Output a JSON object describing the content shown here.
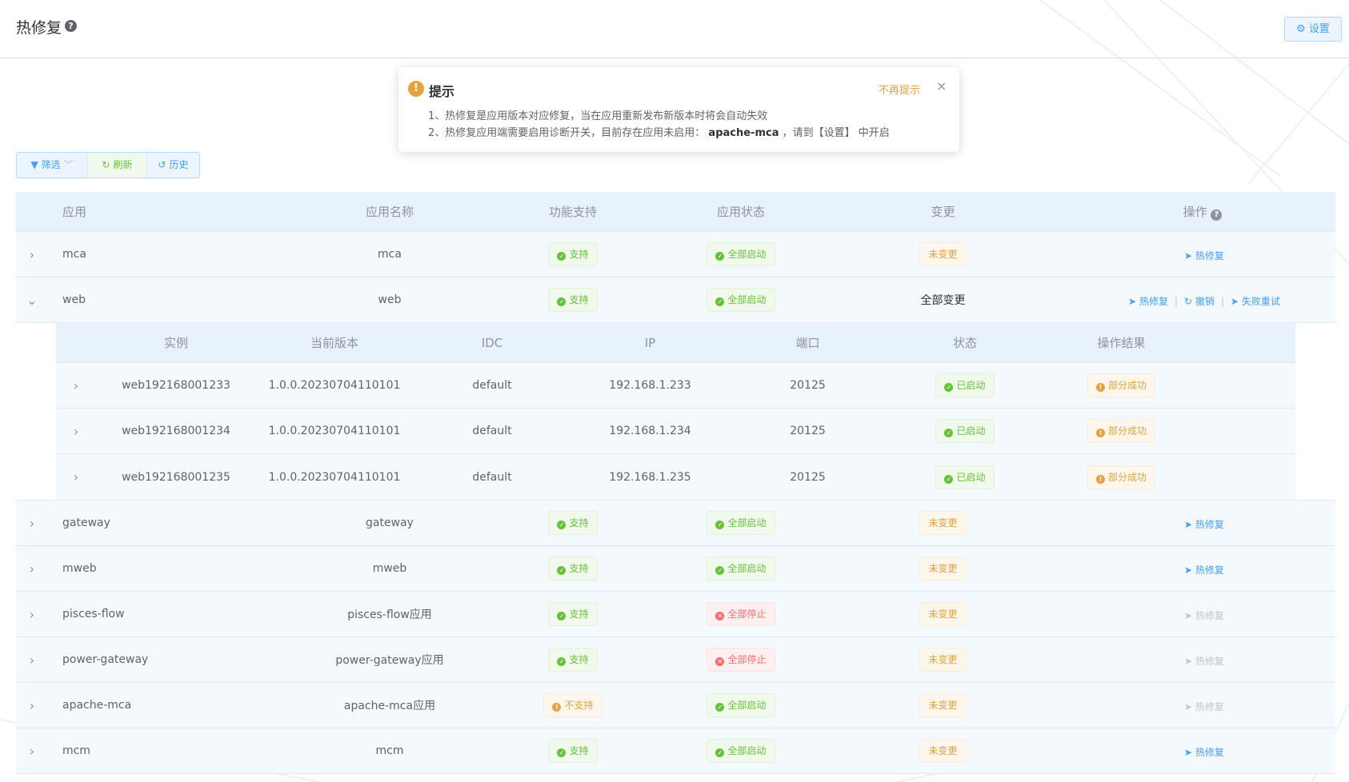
{
  "header": {
    "title": "热修复",
    "help_icon": "?",
    "settings_label": "设置",
    "settings_icon": "⚙"
  },
  "notice": {
    "title": "提示",
    "dismiss": "不再提示",
    "close": "×",
    "line1": "1、热修复是应用版本对应修复，当在应用重新发布新版本时将会自动失效",
    "line2_pre": "2、热修复应用端需要启用诊断开关，目前存在应用未启用：",
    "line2_app": "apache-mca",
    "line2_post": "，请到【设置】 中开启"
  },
  "toolbar": {
    "filter_label": "筛选",
    "refresh_label": "刷新",
    "history_label": "历史"
  },
  "main_table": {
    "columns": [
      "应用",
      "应用名称",
      "功能支持",
      "应用状态",
      "变更",
      "操作"
    ],
    "rows": [
      {
        "app": "mca",
        "name": "mca",
        "feature": "支持",
        "state": "全部启动",
        "change": "未变更",
        "op": "热修复"
      },
      {
        "app": "web",
        "name": "web",
        "feature": "支持",
        "state": "全部启动",
        "change": "全部变更",
        "ops": [
          "热修复",
          "撤销",
          "失败重试"
        ]
      },
      {
        "app": "gateway",
        "name": "gateway",
        "feature": "支持",
        "state": "全部启动",
        "change": "未变更",
        "op": "热修复"
      },
      {
        "app": "mweb",
        "name": "mweb",
        "feature": "支持",
        "state": "全部启动",
        "change": "未变更",
        "op": "热修复"
      },
      {
        "app": "pisces-flow",
        "name": "pisces-flow应用",
        "feature": "支持",
        "state": "全部停止",
        "change": "未变更",
        "op": "热修复"
      },
      {
        "app": "power-gateway",
        "name": "power-gateway应用",
        "feature": "支持",
        "state": "全部停止",
        "change": "未变更",
        "op": "热修复"
      },
      {
        "app": "apache-mca",
        "name": "apache-mca应用",
        "feature": "不支持",
        "state": "全部启动",
        "change": "未变更",
        "op": "热修复"
      },
      {
        "app": "mcm",
        "name": "mcm",
        "feature": "支持",
        "state": "全部启动",
        "change": "未变更",
        "op": "热修复"
      }
    ]
  },
  "sub_table": {
    "columns": [
      "实例",
      "当前版本",
      "IDC",
      "IP",
      "端口",
      "状态",
      "操作结果"
    ],
    "rows": [
      {
        "instance": "web192168001233",
        "version": "1.0.0.20230704110101",
        "idc": "default",
        "ip": "192.168.1.233",
        "port": "20125",
        "state": "已启动",
        "result": "部分成功"
      },
      {
        "instance": "web192168001234",
        "version": "1.0.0.20230704110101",
        "idc": "default",
        "ip": "192.168.1.234",
        "port": "20125",
        "state": "已启动",
        "result": "部分成功"
      },
      {
        "instance": "web192168001235",
        "version": "1.0.0.20230704110101",
        "idc": "default",
        "ip": "192.168.1.235",
        "port": "20125",
        "state": "已启动",
        "result": "部分成功"
      }
    ]
  },
  "icons": {
    "expand_collapsed": "chevron-right-icon",
    "expand_open": "chevron-down-icon",
    "status_ok": "check-circle-icon",
    "status_err": "close-circle-icon",
    "status_warn": "warning-circle-icon",
    "hotfix": "send-icon",
    "undo": "refresh-icon",
    "filter": "funnel-icon",
    "history": "history-icon"
  },
  "colors": {
    "primary": "#409eff",
    "success": "#67c23a",
    "danger": "#f56c6c",
    "warning": "#e6a23c",
    "header_bg": "#e8f2fd",
    "row_bg": "#f4f9fe"
  }
}
